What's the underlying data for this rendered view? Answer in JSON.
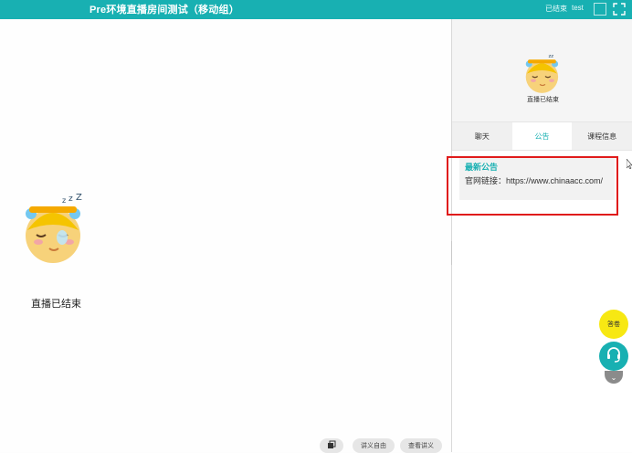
{
  "window": {
    "title": "Pre环境直播房间测试（移动组）",
    "status": "已结束",
    "user": "test"
  },
  "main": {
    "ended_text": "直播已结束"
  },
  "bottom_toolbar": {
    "items": [
      {
        "label": "讲义自由",
        "icon": "copy-icon"
      },
      {
        "label": "查看讲义"
      }
    ]
  },
  "sidebar": {
    "ended_text": "直播已结束",
    "tabs": [
      {
        "label": "聊天"
      },
      {
        "label": "公告"
      },
      {
        "label": "课程信息"
      }
    ],
    "active_tab": "公告",
    "notice": {
      "title": "最新公告",
      "body": "官网链接：https://www.chinaacc.com/"
    }
  },
  "floating": {
    "answer_label": "答卷",
    "support_icon": "headset-icon",
    "collapse_icon": "chevron-down-icon"
  },
  "colors": {
    "accent": "#18b0b2",
    "highlight_border": "#e01b1b",
    "answer_button": "#f7e813"
  }
}
